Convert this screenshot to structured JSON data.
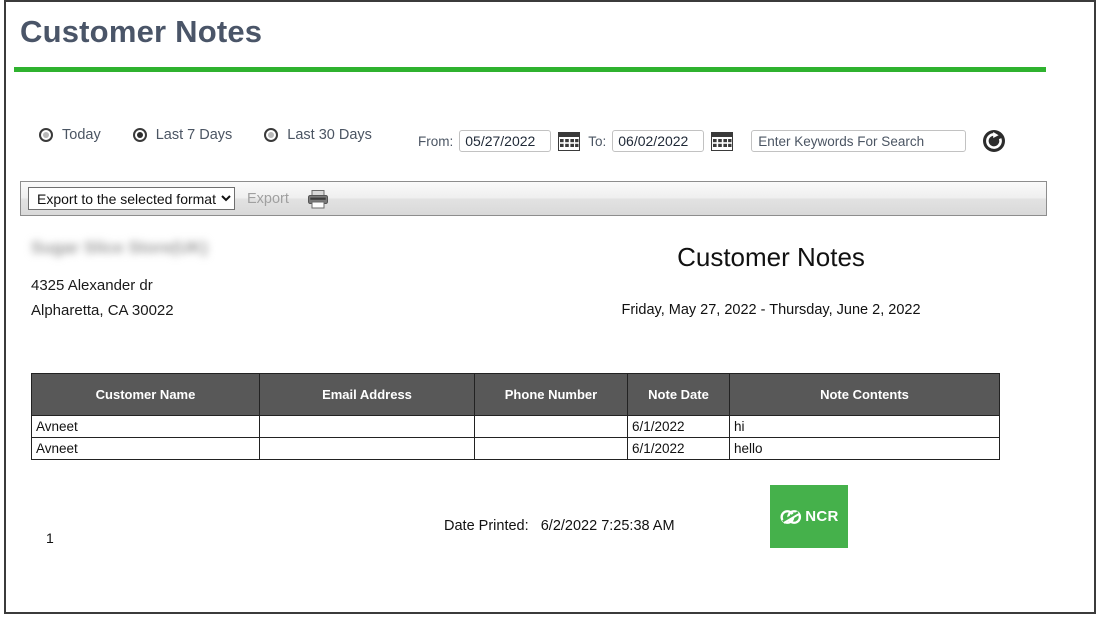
{
  "window": {
    "title": "Customer Notes",
    "accent_green": "#2fb22f",
    "title_color": "#4a5568"
  },
  "filters": {
    "radios": [
      {
        "label": "Today",
        "selected": false,
        "name": "radio-today"
      },
      {
        "label": "Last 7 Days",
        "selected": true,
        "name": "radio-last-7-days"
      },
      {
        "label": "Last 30 Days",
        "selected": false,
        "name": "radio-last-30-days"
      }
    ],
    "from_label": "From:",
    "from_value": "05/27/2022",
    "to_label": "To:",
    "to_value": "06/02/2022",
    "search_placeholder": "Enter Keywords For Search",
    "search_value": "",
    "calendar_icon": "calendar-icon",
    "refresh_icon": "refresh-icon"
  },
  "toolbar": {
    "export_select_value": "Export to the selected format",
    "export_options": [
      "Export to the selected format"
    ],
    "export_label": "Export",
    "print_icon": "printer-icon"
  },
  "report": {
    "business_name": "",
    "address_line1": "4325 Alexander dr",
    "address_line2": "Alpharetta, CA 30022",
    "title": "Customer Notes",
    "date_range": "Friday, May 27, 2022 - Thursday, June 2, 2022",
    "columns": [
      "Customer Name",
      "Email Address",
      "Phone Number",
      "Note Date",
      "Note Contents"
    ],
    "rows": [
      {
        "customer_name": "Avneet",
        "email_address": "",
        "phone_number": "",
        "note_date": "6/1/2022",
        "note_contents": "hi"
      },
      {
        "customer_name": "Avneet",
        "email_address": "",
        "phone_number": "",
        "note_date": "6/1/2022",
        "note_contents": "hello"
      }
    ],
    "page_number": "1",
    "date_printed_label": "Date Printed:",
    "date_printed_value": "6/2/2022 7:25:38 AM",
    "logo_text": "NCR",
    "logo_color": "#45b14b"
  }
}
